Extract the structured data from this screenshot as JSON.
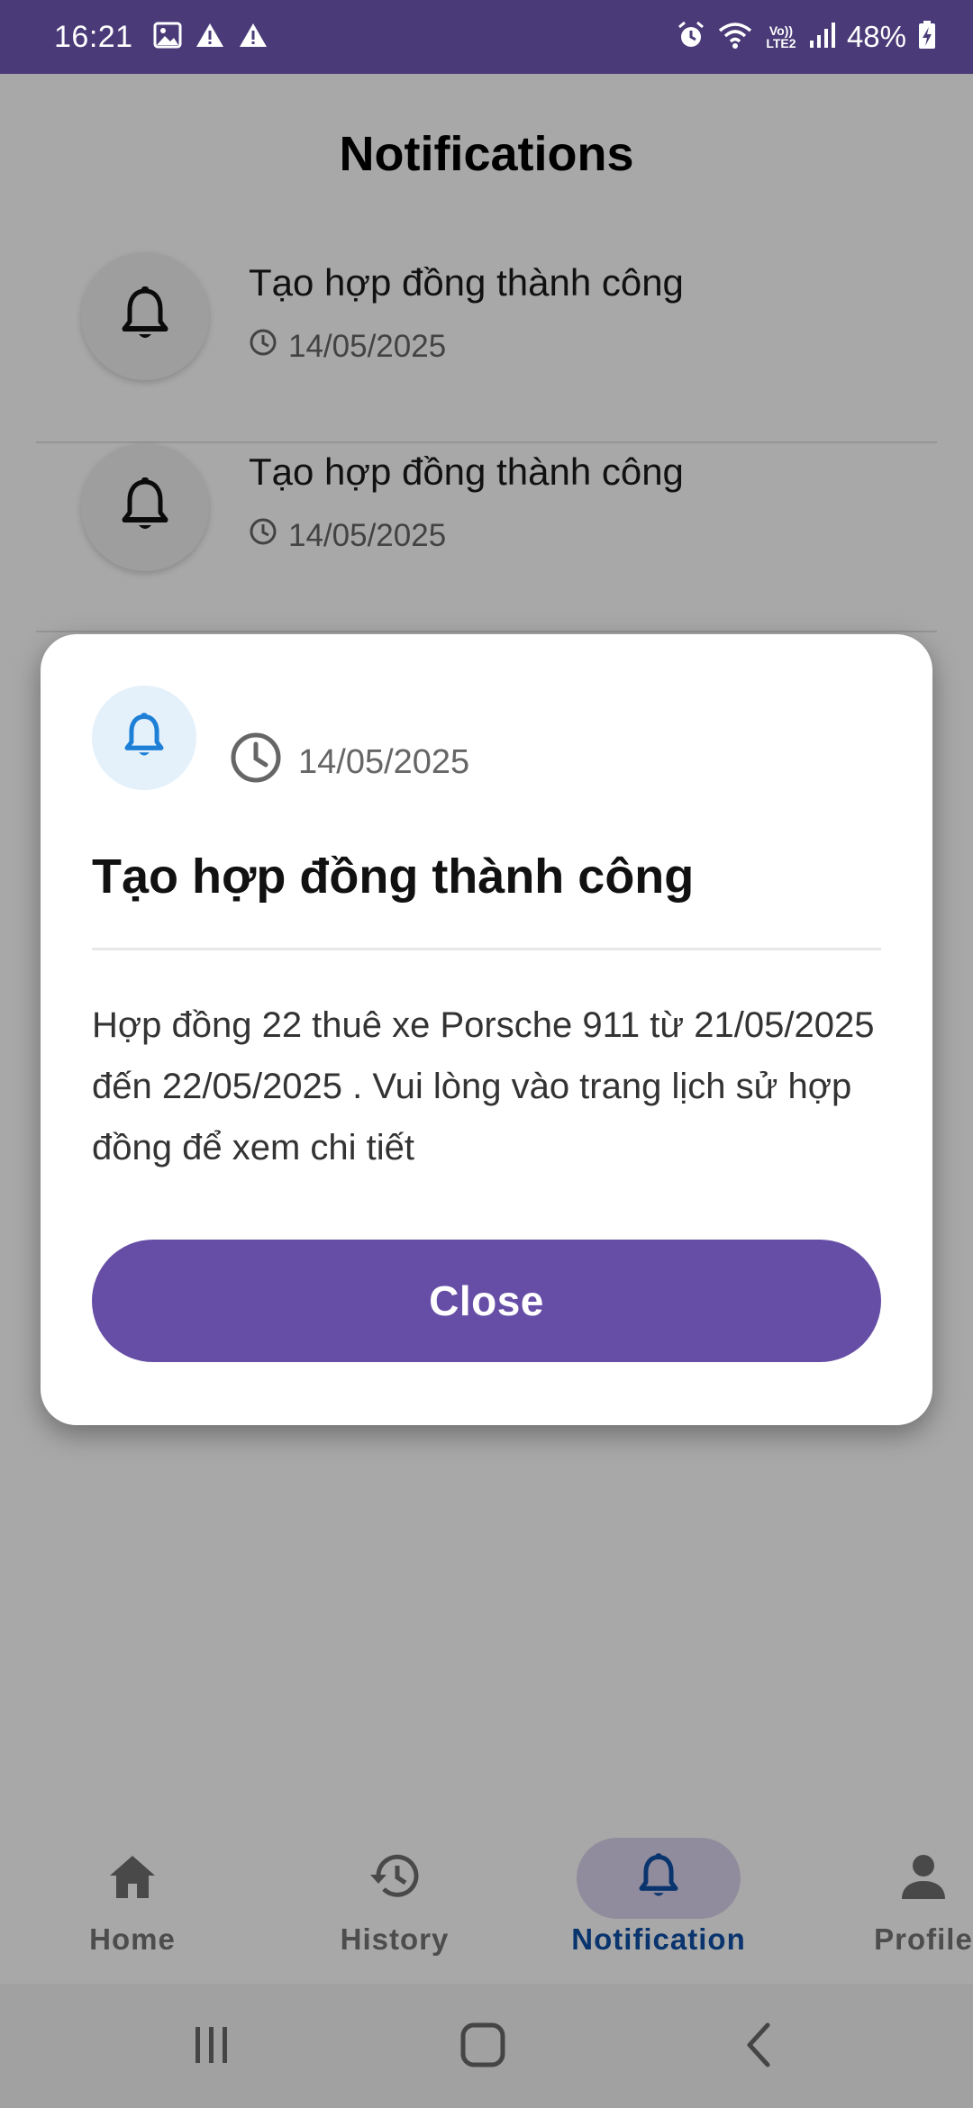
{
  "status_bar": {
    "time": "16:21",
    "battery_text": "48%",
    "lte_label": "Vo)) LTE2",
    "icons": [
      "image-icon",
      "warning-icon",
      "warning-icon",
      "alarm-icon",
      "wifi-icon",
      "signal-icon",
      "battery-charging-icon"
    ]
  },
  "header": {
    "title": "Notifications"
  },
  "notifications": [
    {
      "title": "Tạo hợp đồng thành công",
      "date": "14/05/2025"
    },
    {
      "title": "Tạo hợp đồng thành công",
      "date": "14/05/2025"
    }
  ],
  "dialog": {
    "date": "14/05/2025",
    "title": "Tạo hợp đồng thành công",
    "body": "Hợp đồng 22 thuê xe Porsche 911 từ 21/05/2025 đến 22/05/2025 . Vui lòng vào trang lịch sử hợp đồng để xem chi tiết",
    "close_label": "Close"
  },
  "bottom_nav": {
    "items": [
      {
        "label": "Home",
        "icon": "home-icon",
        "active": false
      },
      {
        "label": "History",
        "icon": "history-icon",
        "active": false
      },
      {
        "label": "Notification",
        "icon": "bell-icon",
        "active": true
      },
      {
        "label": "Profile",
        "icon": "person-icon",
        "active": false
      }
    ]
  },
  "colors": {
    "status_bar": "#4a3b78",
    "primary_button": "#664ea6",
    "active_nav_label": "#0f4fa8",
    "active_nav_pill": "#dcd5ee",
    "dialog_icon_bg": "#e4f1fb",
    "dialog_bell": "#1d7fd6"
  }
}
